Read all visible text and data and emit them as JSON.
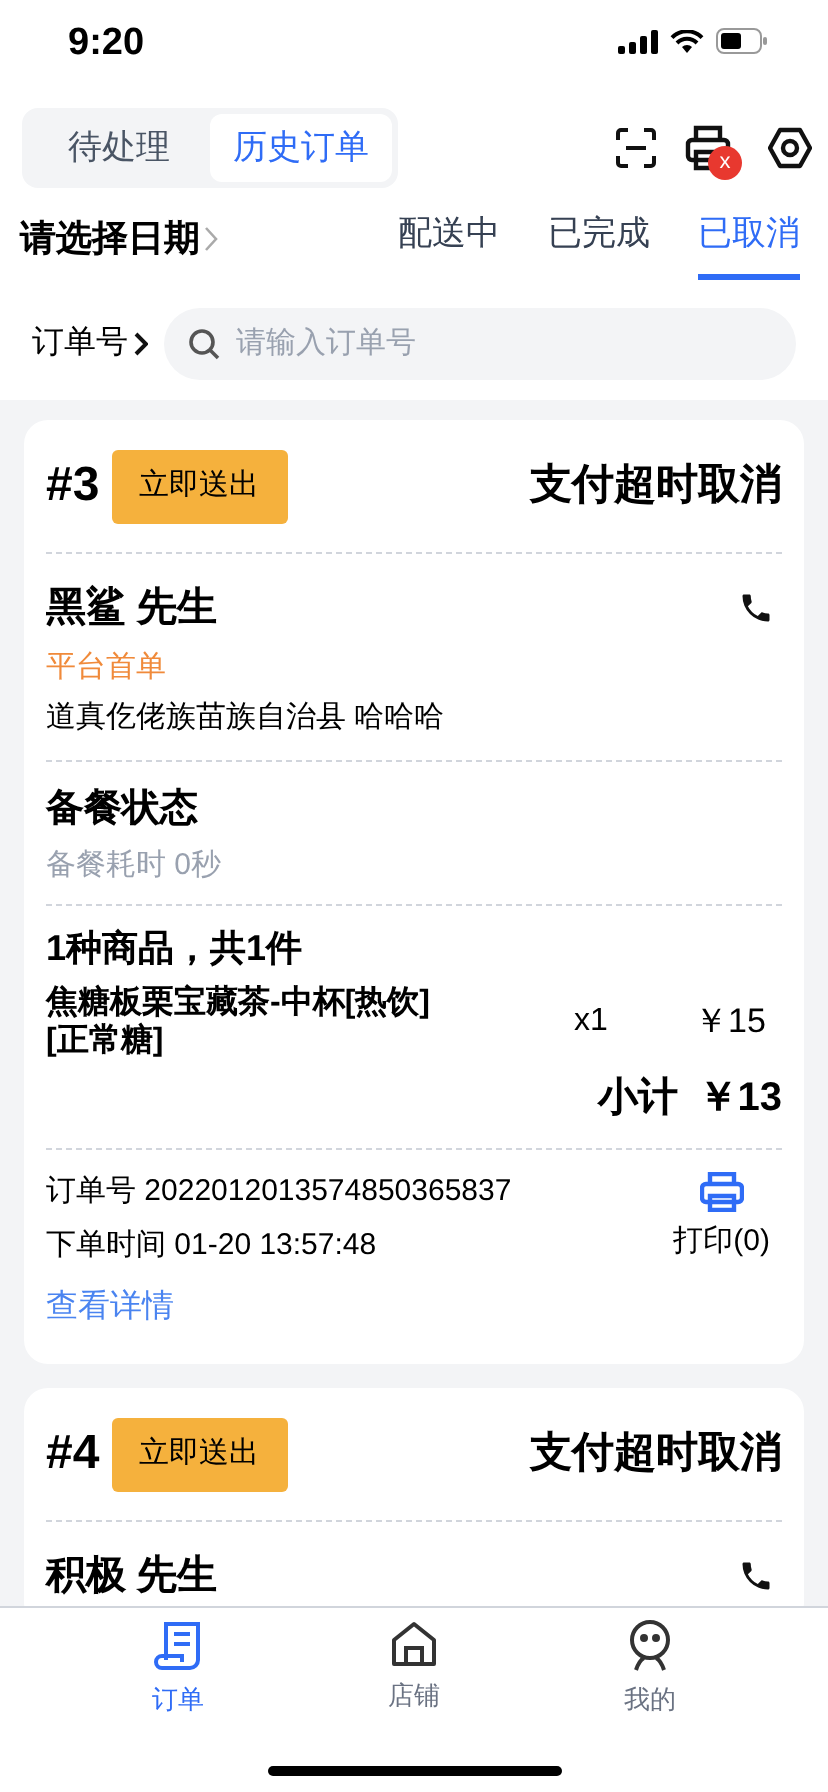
{
  "status_bar": {
    "time": "9:20"
  },
  "top_tabs": [
    {
      "label": "待处理",
      "selected": false
    },
    {
      "label": "历史订单",
      "selected": true
    }
  ],
  "toolbar": {
    "printer_badge": "x"
  },
  "filter": {
    "date_label": "请选择日期",
    "tabs": [
      {
        "label": "配送中",
        "selected": false
      },
      {
        "label": "已完成",
        "selected": false
      },
      {
        "label": "已取消",
        "selected": true
      }
    ]
  },
  "search": {
    "label": "订单号",
    "placeholder": "请输入订单号"
  },
  "orders": [
    {
      "number": "#3",
      "action": "立即送出",
      "status": "支付超时取消",
      "customer": "黑鲨 先生",
      "tag": "平台首单",
      "address": "道真仡佬族苗族自治县 哈哈哈",
      "prep_title": "备餐状态",
      "prep_time": "备餐耗时 0秒",
      "items_summary": "1种商品，共1件",
      "items": [
        {
          "name": "焦糖板栗宝藏茶-中杯[热饮][正常糖]",
          "qty": "x1",
          "price": "￥15"
        }
      ],
      "subtotal_label": "小计",
      "subtotal": "￥13",
      "order_no": "订单号 2022012013574850365837",
      "order_time": "下单时间 01-20 13:57:48",
      "print": "打印(0)",
      "detail_link": "查看详情"
    },
    {
      "number": "#4",
      "action": "立即送出",
      "status": "支付超时取消",
      "customer": "积极 先生"
    }
  ],
  "bottom_nav": [
    {
      "kind": "orders",
      "label": "订单",
      "selected": true
    },
    {
      "kind": "store",
      "label": "店铺",
      "selected": false
    },
    {
      "kind": "me",
      "label": "我的",
      "selected": false
    }
  ]
}
